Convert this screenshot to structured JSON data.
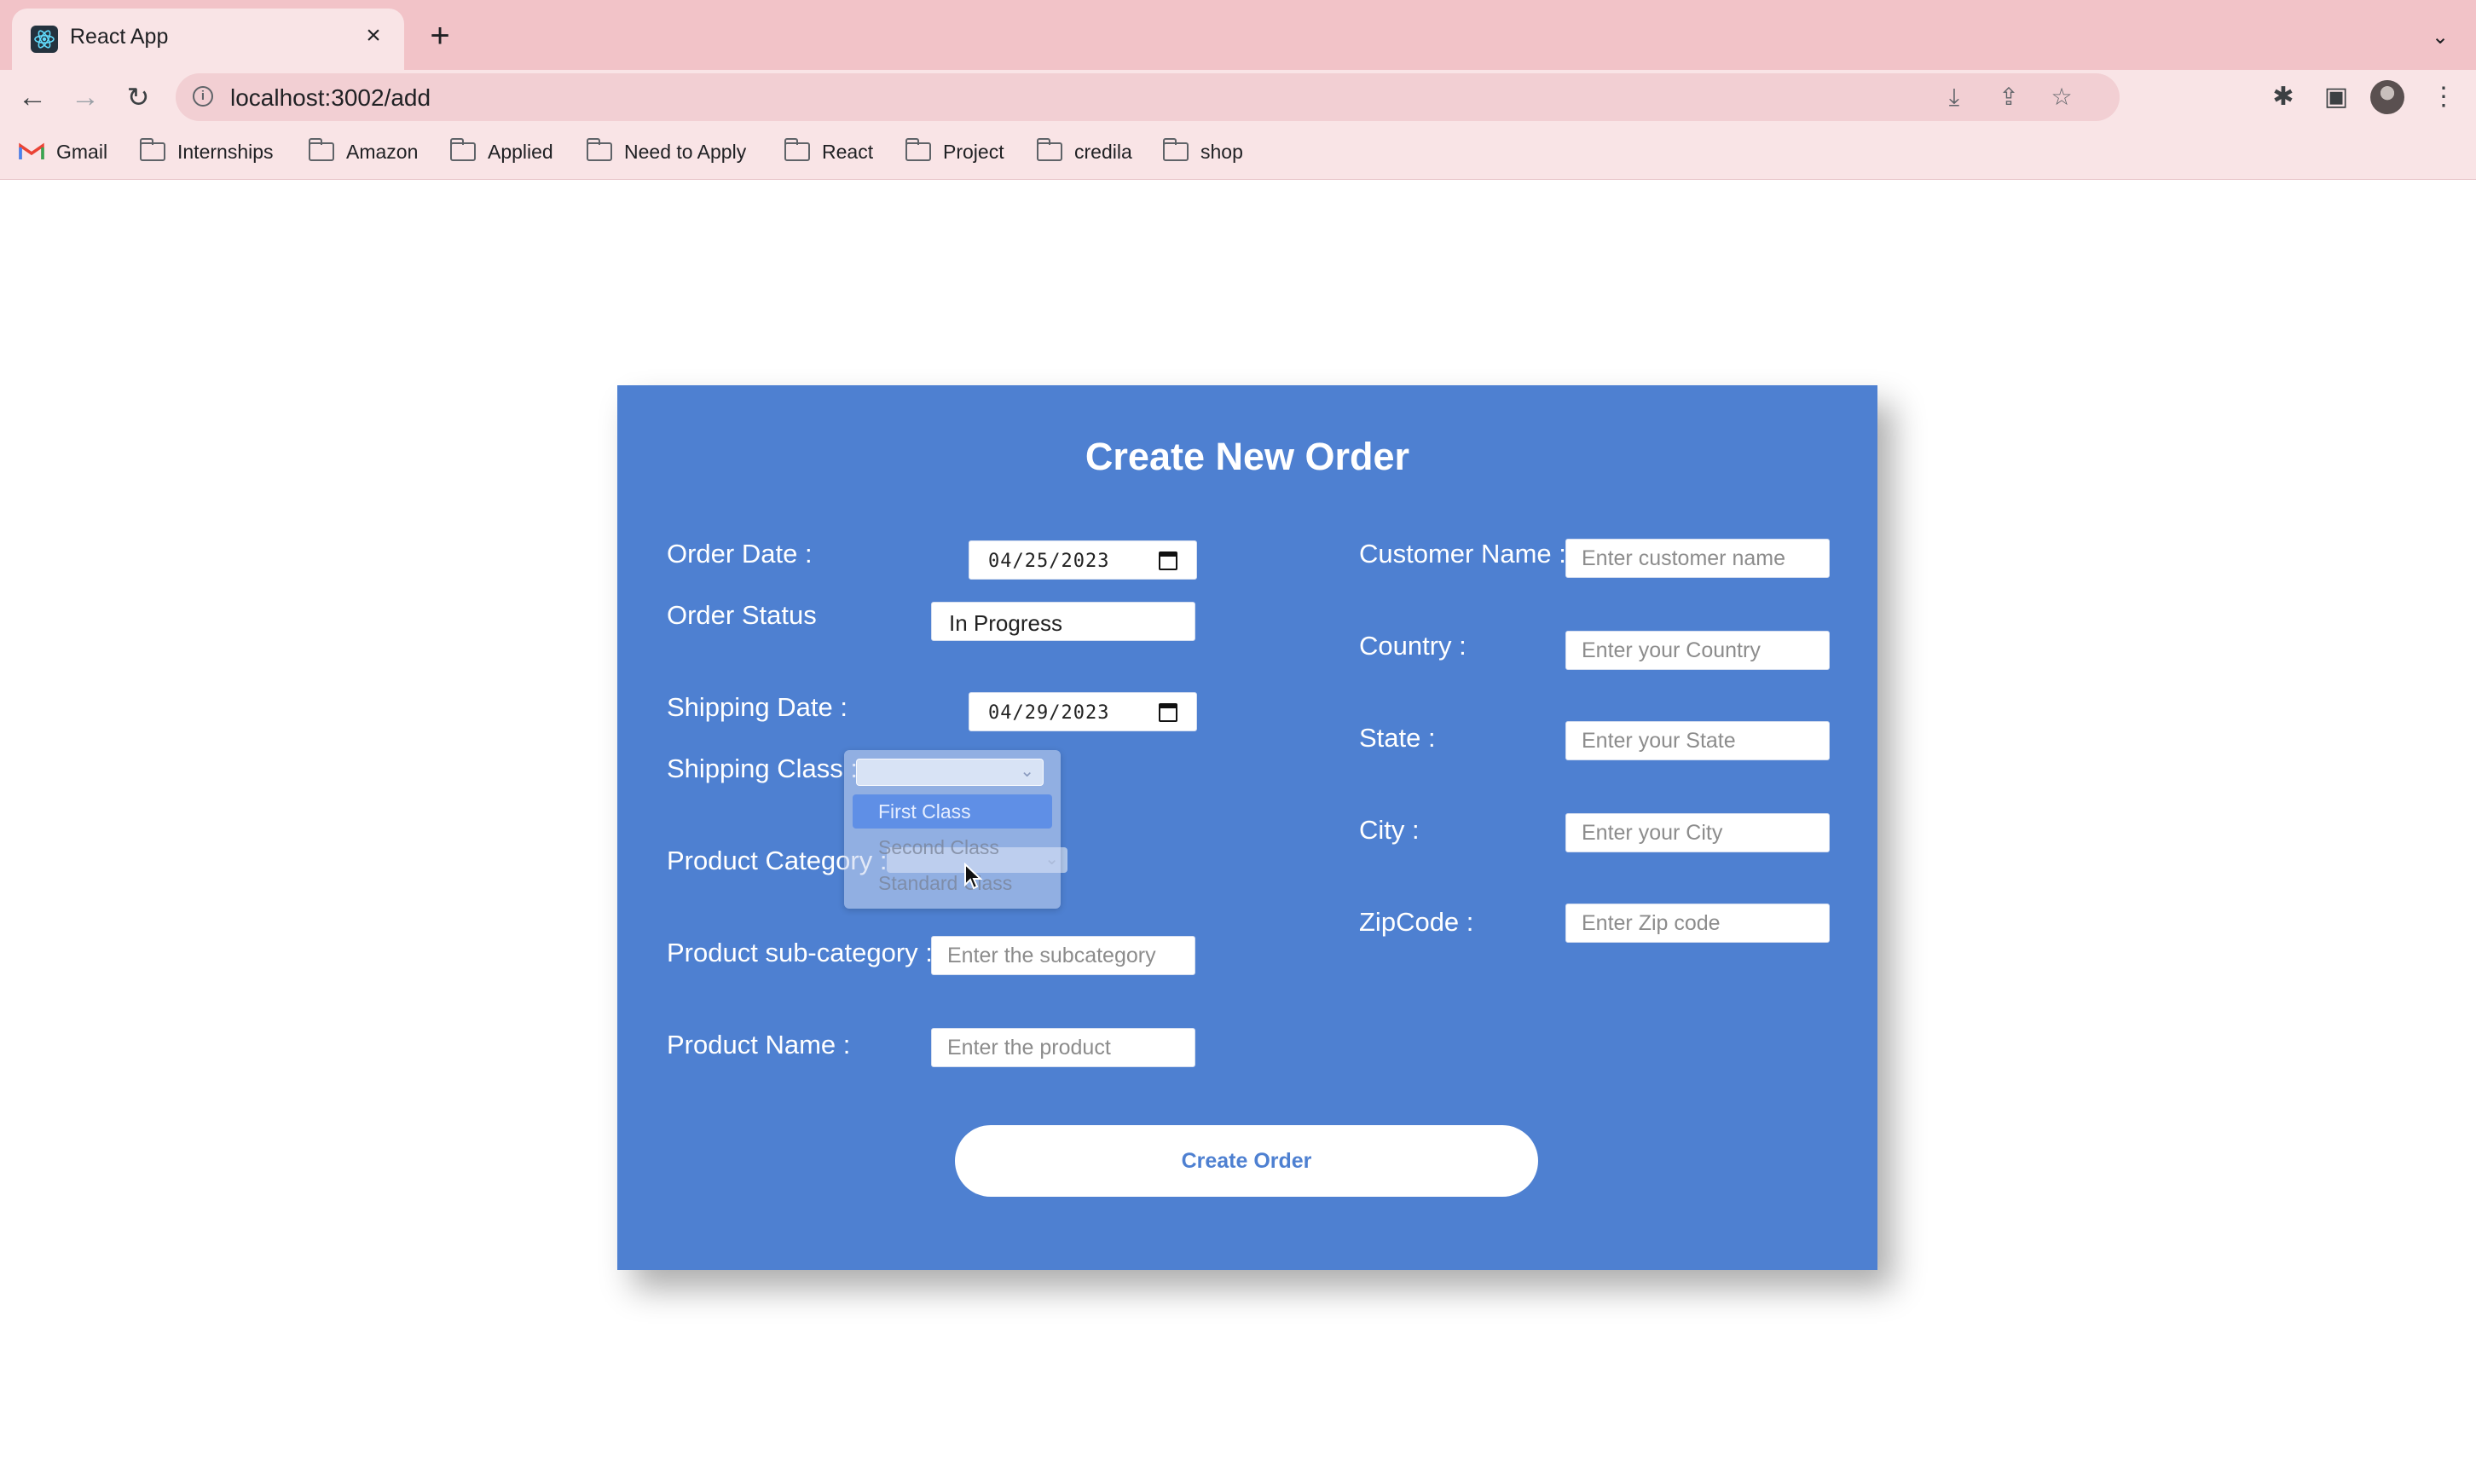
{
  "browser": {
    "tab_title": "React App",
    "url": "localhost:3002/add",
    "bookmarks": [
      "Gmail",
      "Internships",
      "Amazon",
      "Applied",
      "Need to Apply",
      "React",
      "Project",
      "credila",
      "shop"
    ]
  },
  "form": {
    "title": "Create New Order",
    "order_date_label": "Order Date :",
    "order_date_value": "04/25/2023",
    "order_status_label": "Order Status",
    "order_status_value": "In Progress",
    "shipping_date_label": "Shipping Date :",
    "shipping_date_value": "04/29/2023",
    "shipping_class_label": "Shipping Class :",
    "shipping_class_options": [
      "First Class",
      "Second Class",
      "Standard Class"
    ],
    "shipping_class_highlighted": "First Class",
    "product_category_label": "Product Category :",
    "product_subcategory_label": "Product sub-category :",
    "product_subcategory_placeholder": "Enter the subcategory",
    "product_name_label": "Product Name :",
    "product_name_placeholder": "Enter the product",
    "customer_name_label": "Customer Name :",
    "customer_name_placeholder": "Enter customer name",
    "country_label": "Country :",
    "country_placeholder": "Enter your Country",
    "state_label": "State :",
    "state_placeholder": "Enter your State",
    "city_label": "City :",
    "city_placeholder": "Enter your City",
    "zipcode_label": "ZipCode :",
    "zipcode_placeholder": "Enter Zip code",
    "submit_label": "Create Order"
  },
  "colors": {
    "card_background": "#4e80d1",
    "tab_strip": "#f2c3c8",
    "toolbar": "#f9e4e6",
    "dropdown_highlight": "#5f8fe6"
  },
  "icons": [
    "react-favicon",
    "close-icon",
    "plus-icon",
    "back-arrow-icon",
    "forward-arrow-icon",
    "reload-icon",
    "info-icon",
    "install-icon",
    "share-icon",
    "star-icon",
    "extensions-icon",
    "side-panel-icon",
    "menu-icon",
    "folder-icon",
    "gmail-icon",
    "calendar-icon",
    "chevron-down-icon",
    "cursor-icon"
  ]
}
